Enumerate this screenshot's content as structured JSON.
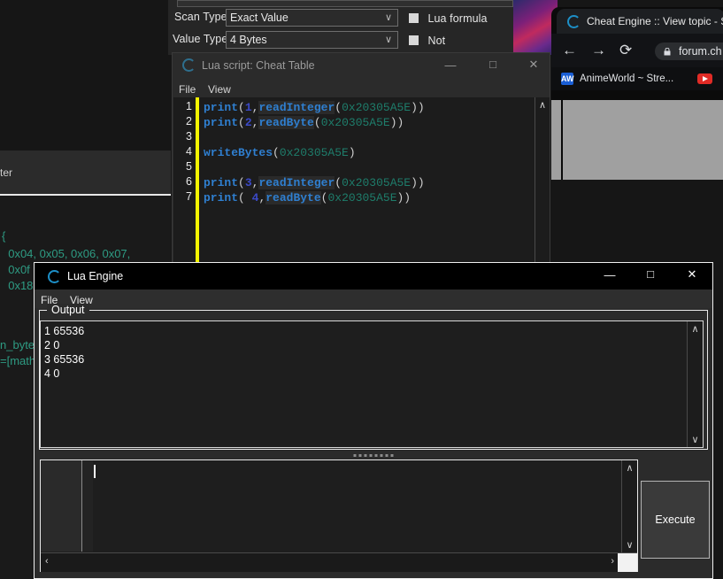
{
  "cheat_engine_main": {
    "scan_type_label": "Scan Type",
    "scan_type_value": "Exact Value",
    "value_type_label": "Value Type",
    "value_type_value": "4 Bytes",
    "lua_formula_label": "Lua formula",
    "not_label": "Not",
    "chevron": "∨"
  },
  "left_window": {
    "partial_label": "ter",
    "code_lines": [
      "{",
      "  0x04, 0x05, 0x06, 0x07,",
      "  0x0f",
      "  0x18"
    ],
    "fragment_1": "n_byte",
    "fragment_2": "=[math"
  },
  "browser": {
    "tab_title": "Cheat Engine :: View topic - S",
    "back_icon": "←",
    "forward_icon": "→",
    "reload_icon": "⟳",
    "url": "forum.ch",
    "bookmark_1": "AnimeWorld ~ Stre...",
    "bookmark_1_chip": "AW"
  },
  "lua_script_window": {
    "title": "Lua script: Cheat Table",
    "menu": [
      "File",
      "View"
    ],
    "minimize": "—",
    "maximize": "□",
    "close": "✕",
    "scroll_up": "∧",
    "line_numbers": [
      "1",
      "2",
      "3",
      "4",
      "5",
      "6",
      "7"
    ],
    "code": [
      {
        "tokens": [
          {
            "t": "print",
            "c": "c-fn"
          },
          {
            "t": "(",
            "c": "c-pun"
          },
          {
            "t": "1",
            "c": "c-num"
          },
          {
            "t": ",",
            "c": "c-pun"
          },
          {
            "t": "readInteger",
            "c": "c-fn2"
          },
          {
            "t": "(",
            "c": "c-pun"
          },
          {
            "t": "0x20305A5E",
            "c": "c-hex"
          },
          {
            "t": "))",
            "c": "c-pun"
          }
        ]
      },
      {
        "tokens": [
          {
            "t": "print",
            "c": "c-fn"
          },
          {
            "t": "(",
            "c": "c-pun"
          },
          {
            "t": "2",
            "c": "c-num"
          },
          {
            "t": ",",
            "c": "c-pun"
          },
          {
            "t": "readByte",
            "c": "c-fn2"
          },
          {
            "t": "(",
            "c": "c-pun"
          },
          {
            "t": "0x20305A5E",
            "c": "c-hex"
          },
          {
            "t": "))",
            "c": "c-pun"
          }
        ]
      },
      {
        "tokens": []
      },
      {
        "tokens": [
          {
            "t": "writeBytes",
            "c": "c-fn"
          },
          {
            "t": "(",
            "c": "c-pun"
          },
          {
            "t": "0x20305A5E",
            "c": "c-hex"
          },
          {
            "t": ")",
            "c": "c-pun"
          }
        ]
      },
      {
        "tokens": []
      },
      {
        "tokens": [
          {
            "t": "print",
            "c": "c-fn"
          },
          {
            "t": "(",
            "c": "c-pun"
          },
          {
            "t": "3",
            "c": "c-num"
          },
          {
            "t": ",",
            "c": "c-pun"
          },
          {
            "t": "readInteger",
            "c": "c-fn2"
          },
          {
            "t": "(",
            "c": "c-pun"
          },
          {
            "t": "0x20305A5E",
            "c": "c-hex"
          },
          {
            "t": "))",
            "c": "c-pun"
          }
        ]
      },
      {
        "tokens": [
          {
            "t": "print",
            "c": "c-fn"
          },
          {
            "t": "( ",
            "c": "c-pun"
          },
          {
            "t": "4",
            "c": "c-num"
          },
          {
            "t": ",",
            "c": "c-pun"
          },
          {
            "t": "readByte",
            "c": "c-fn2"
          },
          {
            "t": "(",
            "c": "c-pun"
          },
          {
            "t": "0x20305A5E",
            "c": "c-hex"
          },
          {
            "t": "))",
            "c": "c-pun"
          }
        ]
      }
    ]
  },
  "lua_engine": {
    "title": "Lua Engine",
    "menu": [
      "File",
      "View"
    ],
    "minimize": "—",
    "maximize": "□",
    "close": "✕",
    "output_legend": "Output",
    "output_lines": [
      "1 65536",
      "2 0",
      "3 65536",
      "4 0"
    ],
    "scroll_up": "∧",
    "scroll_down": "∨",
    "scroll_left": "‹",
    "scroll_right": "›",
    "input_value": "",
    "execute_label": "Execute"
  },
  "colors": {
    "accent_yellow": "#f4f400",
    "window_bg": "#2b2b2b",
    "editor_bg": "#1c1c1c",
    "active_title_bg": "#000000",
    "keyword_blue": "#2f7fd0",
    "hex_teal": "#1e7d6b",
    "number_blue": "#3b49c6"
  }
}
